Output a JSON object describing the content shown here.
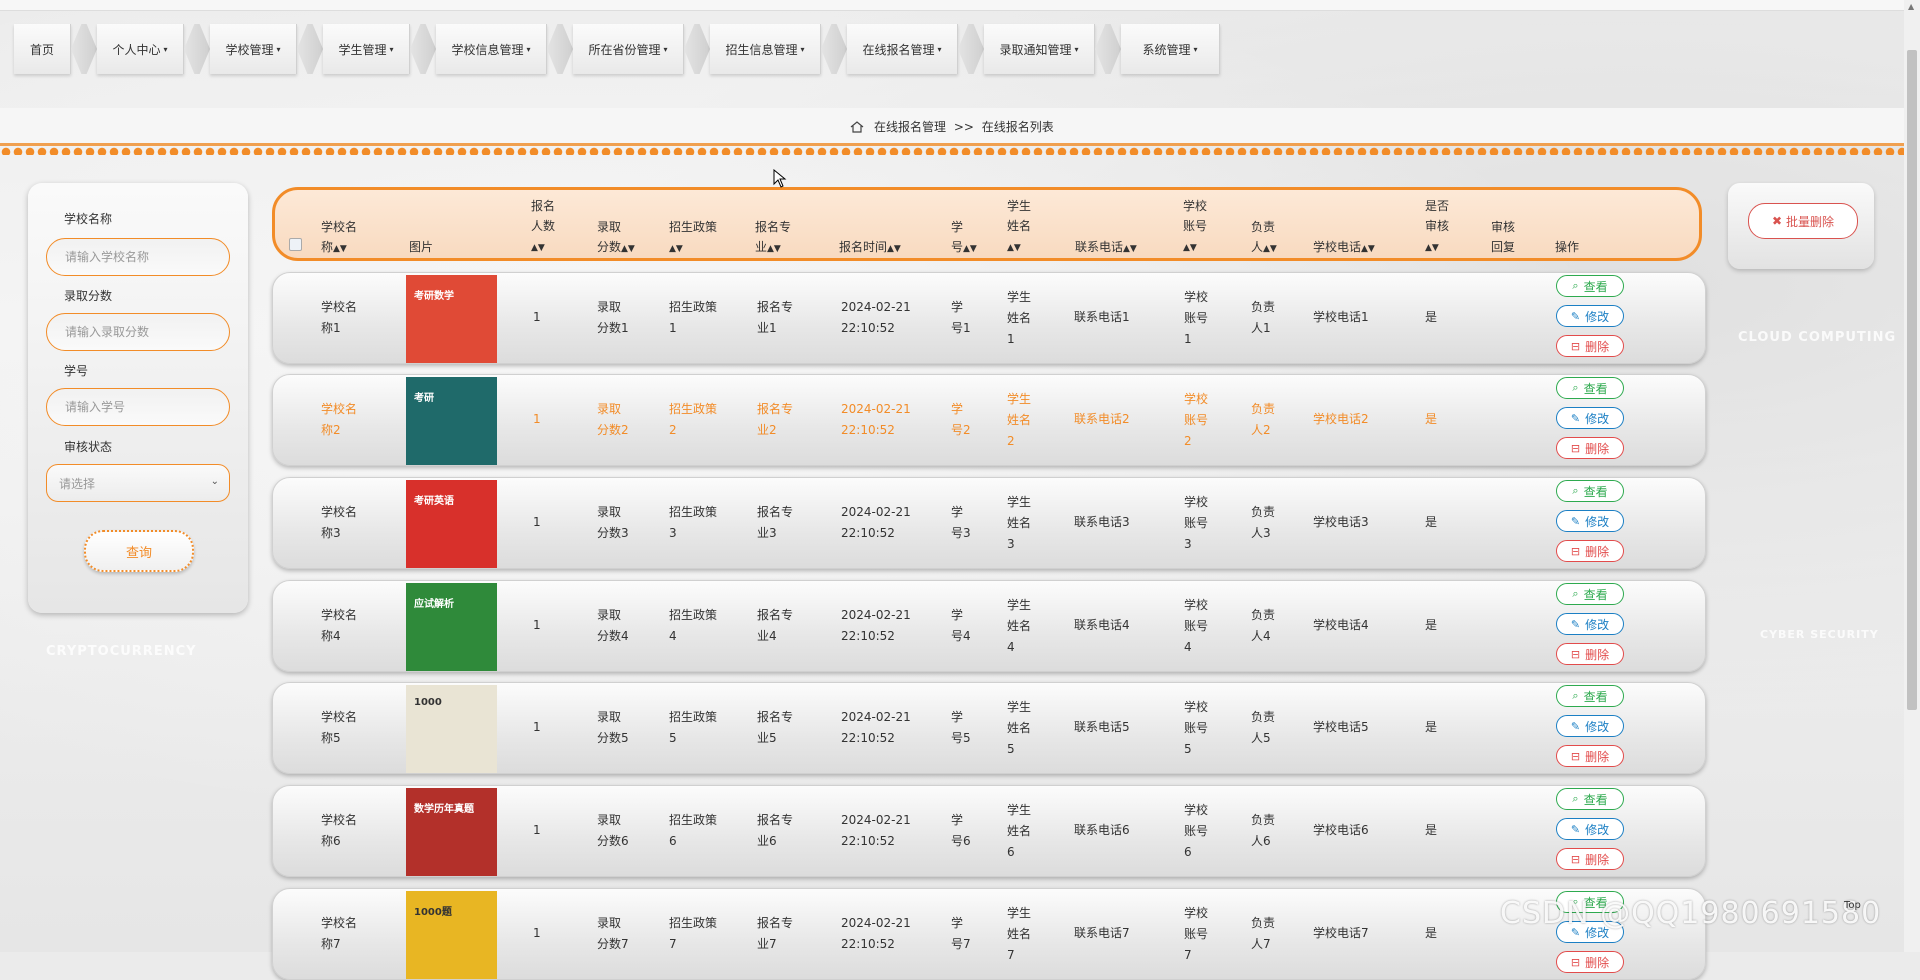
{
  "nav": [
    {
      "label": "首页",
      "caret": false
    },
    {
      "label": "个人中心",
      "caret": true
    },
    {
      "label": "学校管理",
      "caret": true
    },
    {
      "label": "学生管理",
      "caret": true
    },
    {
      "label": "学校信息管理",
      "caret": true
    },
    {
      "label": "所在省份管理",
      "caret": true
    },
    {
      "label": "招生信息管理",
      "caret": true
    },
    {
      "label": "在线报名管理",
      "caret": true
    },
    {
      "label": "录取通知管理",
      "caret": true
    },
    {
      "label": "系统管理",
      "caret": true
    }
  ],
  "breadcrumb": {
    "parent": "在线报名管理",
    "sep": ">>",
    "current": "在线报名列表"
  },
  "background_text": {
    "left": "CRYPTOCURRENCY",
    "right": "CLOUD COMPUTING",
    "right2": "CYBER SECURITY"
  },
  "search": {
    "school_label": "学校名称",
    "school_placeholder": "请输入学校名称",
    "score_label": "录取分数",
    "score_placeholder": "请输入录取分数",
    "stuno_label": "学号",
    "stuno_placeholder": "请输入学号",
    "status_label": "审核状态",
    "status_value": "请选择",
    "query_button": "查询"
  },
  "batch_delete": "批量删除",
  "table": {
    "headers": {
      "school": [
        "学校名",
        "称"
      ],
      "image": "图片",
      "count": [
        "报名",
        "人数"
      ],
      "score": [
        "录取",
        "分数"
      ],
      "policy": "招生政策",
      "major": [
        "报名专",
        "业"
      ],
      "time": "报名时间",
      "stuno": [
        "学",
        "号"
      ],
      "stuname": [
        "学生",
        "姓名"
      ],
      "phone": "联系电话",
      "account": [
        "学校",
        "账号"
      ],
      "leader": [
        "负责",
        "人"
      ],
      "school_phone": "学校电话",
      "audit": [
        "是否",
        "审核"
      ],
      "reply": [
        "审核",
        "回复"
      ],
      "ops": "操作"
    },
    "op_labels": {
      "view": "查看",
      "edit": "修改",
      "delete": "删除"
    },
    "rows": [
      {
        "school": [
          "学校名",
          "称1"
        ],
        "count": "1",
        "score": [
          "录取",
          "分数1"
        ],
        "policy": [
          "招生政策",
          "1"
        ],
        "major": [
          "报名专",
          "业1"
        ],
        "time": [
          "2024-02-21",
          "22:10:52"
        ],
        "stuno": [
          "学",
          "号1"
        ],
        "stuname": [
          "学生",
          "姓名",
          "1"
        ],
        "phone": "联系电话1",
        "account": [
          "学校",
          "账号",
          "1"
        ],
        "leader": [
          "负责",
          "人1"
        ],
        "school_phone": "学校电话1",
        "audit": "是",
        "reply": "",
        "cover": "#e04a36",
        "cover_text": "考研数学"
      },
      {
        "school": [
          "学校名",
          "称2"
        ],
        "count": "1",
        "score": [
          "录取",
          "分数2"
        ],
        "policy": [
          "招生政策",
          "2"
        ],
        "major": [
          "报名专",
          "业2"
        ],
        "time": [
          "2024-02-21",
          "22:10:52"
        ],
        "stuno": [
          "学",
          "号2"
        ],
        "stuname": [
          "学生",
          "姓名",
          "2"
        ],
        "phone": "联系电话2",
        "account": [
          "学校",
          "账号",
          "2"
        ],
        "leader": [
          "负责",
          "人2"
        ],
        "school_phone": "学校电话2",
        "audit": "是",
        "reply": "",
        "cover": "#1f6a6a",
        "cover_text": "考研"
      },
      {
        "school": [
          "学校名",
          "称3"
        ],
        "count": "1",
        "score": [
          "录取",
          "分数3"
        ],
        "policy": [
          "招生政策",
          "3"
        ],
        "major": [
          "报名专",
          "业3"
        ],
        "time": [
          "2024-02-21",
          "22:10:52"
        ],
        "stuno": [
          "学",
          "号3"
        ],
        "stuname": [
          "学生",
          "姓名",
          "3"
        ],
        "phone": "联系电话3",
        "account": [
          "学校",
          "账号",
          "3"
        ],
        "leader": [
          "负责",
          "人3"
        ],
        "school_phone": "学校电话3",
        "audit": "是",
        "reply": "",
        "cover": "#d8302b",
        "cover_text": "考研英语"
      },
      {
        "school": [
          "学校名",
          "称4"
        ],
        "count": "1",
        "score": [
          "录取",
          "分数4"
        ],
        "policy": [
          "招生政策",
          "4"
        ],
        "major": [
          "报名专",
          "业4"
        ],
        "time": [
          "2024-02-21",
          "22:10:52"
        ],
        "stuno": [
          "学",
          "号4"
        ],
        "stuname": [
          "学生",
          "姓名",
          "4"
        ],
        "phone": "联系电话4",
        "account": [
          "学校",
          "账号",
          "4"
        ],
        "leader": [
          "负责",
          "人4"
        ],
        "school_phone": "学校电话4",
        "audit": "是",
        "reply": "",
        "cover": "#2f8a3a",
        "cover_text": "应试解析"
      },
      {
        "school": [
          "学校名",
          "称5"
        ],
        "count": "1",
        "score": [
          "录取",
          "分数5"
        ],
        "policy": [
          "招生政策",
          "5"
        ],
        "major": [
          "报名专",
          "业5"
        ],
        "time": [
          "2024-02-21",
          "22:10:52"
        ],
        "stuno": [
          "学",
          "号5"
        ],
        "stuname": [
          "学生",
          "姓名",
          "5"
        ],
        "phone": "联系电话5",
        "account": [
          "学校",
          "账号",
          "5"
        ],
        "leader": [
          "负责",
          "人5"
        ],
        "school_phone": "学校电话5",
        "audit": "是",
        "reply": "",
        "cover": "#e9e4d4",
        "cover_text": "1000"
      },
      {
        "school": [
          "学校名",
          "称6"
        ],
        "count": "1",
        "score": [
          "录取",
          "分数6"
        ],
        "policy": [
          "招生政策",
          "6"
        ],
        "major": [
          "报名专",
          "业6"
        ],
        "time": [
          "2024-02-21",
          "22:10:52"
        ],
        "stuno": [
          "学",
          "号6"
        ],
        "stuname": [
          "学生",
          "姓名",
          "6"
        ],
        "phone": "联系电话6",
        "account": [
          "学校",
          "账号",
          "6"
        ],
        "leader": [
          "负责",
          "人6"
        ],
        "school_phone": "学校电话6",
        "audit": "是",
        "reply": "",
        "cover": "#b3302a",
        "cover_text": "数学历年真题"
      },
      {
        "school": [
          "学校名",
          "称7"
        ],
        "count": "1",
        "score": [
          "录取",
          "分数7"
        ],
        "policy": [
          "招生政策",
          "7"
        ],
        "major": [
          "报名专",
          "业7"
        ],
        "time": [
          "2024-02-21",
          "22:10:52"
        ],
        "stuno": [
          "学",
          "号7"
        ],
        "stuname": [
          "学生",
          "姓名",
          "7"
        ],
        "phone": "联系电话7",
        "account": [
          "学校",
          "账号",
          "7"
        ],
        "leader": [
          "负责",
          "人7"
        ],
        "school_phone": "学校电话7",
        "audit": "是",
        "reply": "",
        "cover": "#e8b623",
        "cover_text": "1000题"
      }
    ]
  },
  "watermark": "CSDN @QQ1980691580",
  "top_link": "Top"
}
